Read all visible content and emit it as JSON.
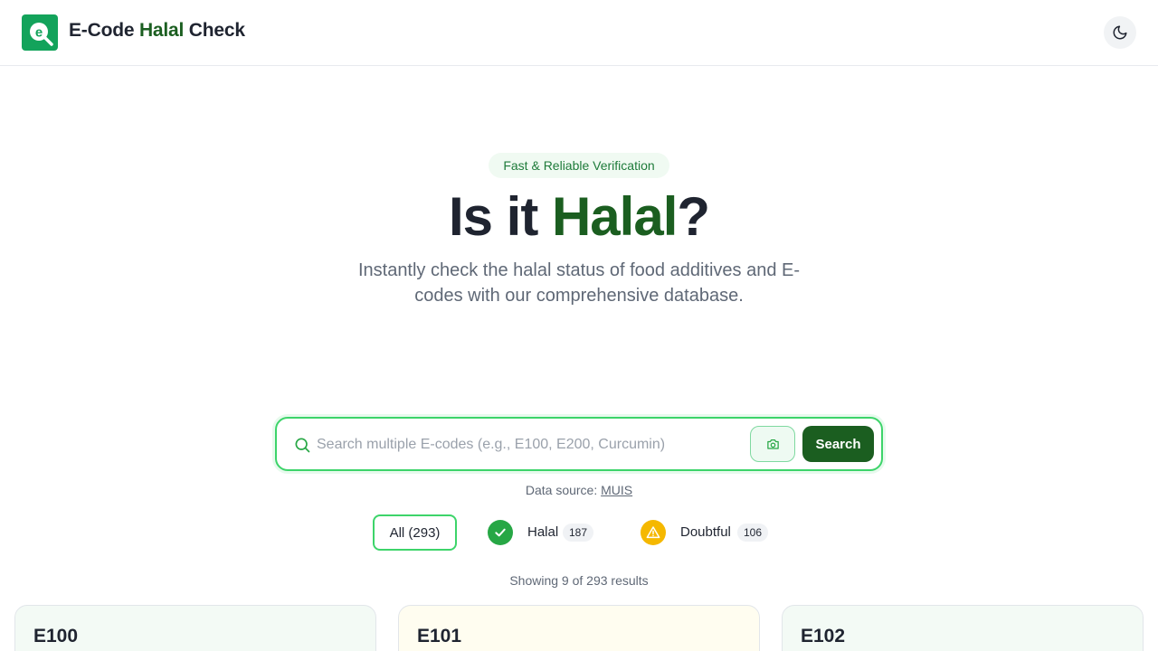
{
  "header": {
    "brand_part1": "E-Code ",
    "brand_accent": "Halal",
    "brand_part3": " Check",
    "logo_icon": "search-e-icon",
    "theme_toggle_icon": "moon-icon"
  },
  "hero": {
    "badge": "Fast & Reliable Verification",
    "title_part1": "Is it ",
    "title_accent": "Halal",
    "title_part3": "?",
    "subtitle": "Instantly check the halal status of food additives and E-codes with our comprehensive database."
  },
  "search": {
    "placeholder": "Search multiple E-codes (e.g., E100, E200, Curcumin)",
    "value": "",
    "button_label": "Search",
    "camera_icon": "camera-icon"
  },
  "data_source": {
    "prefix": "Data source: ",
    "link_text": "MUIS"
  },
  "filters": {
    "all_label": "All (293)",
    "halal": {
      "label": "Halal",
      "count": "187",
      "icon": "check-icon"
    },
    "doubtful": {
      "label": "Doubtful",
      "count": "106",
      "icon": "warning-icon"
    }
  },
  "results": {
    "showing": "Showing 9 of 293 results"
  },
  "cards": [
    {
      "code": "E100"
    },
    {
      "code": "E101"
    },
    {
      "code": "E102"
    }
  ],
  "colors": {
    "brand_green": "#13a35b",
    "accent_dark_green": "#1b5e20",
    "input_border": "#3dd46a",
    "halal_green": "#27a745",
    "doubtful_yellow": "#f5b800"
  }
}
